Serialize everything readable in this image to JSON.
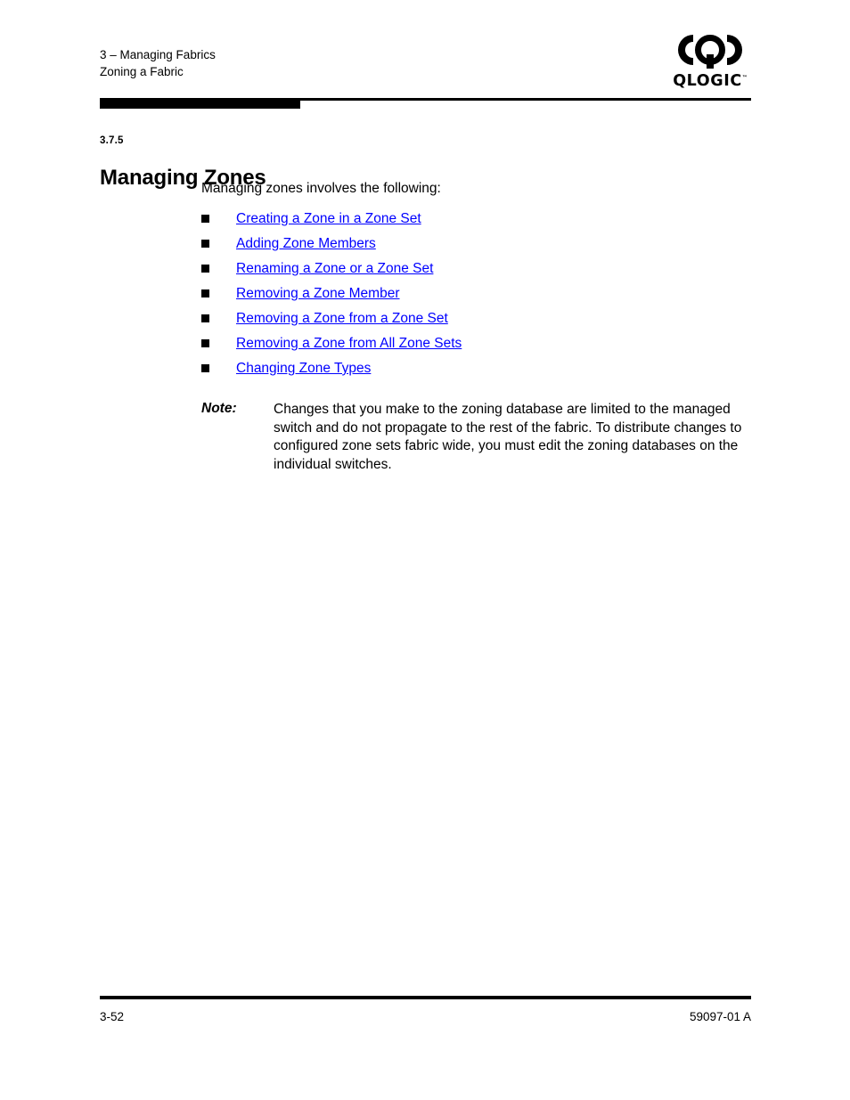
{
  "header": {
    "line1": "3 – Managing Fabrics",
    "line2": "Zoning a Fabric",
    "logo_wordmark": "QLOGIC",
    "logo_tm": "™"
  },
  "section": {
    "number": "3.7.5",
    "title": "Managing Zones"
  },
  "body": {
    "intro": "Managing zones involves the following:",
    "links": [
      {
        "label": "Creating a Zone in a Zone Set"
      },
      {
        "label": "Adding Zone Members"
      },
      {
        "label": "Renaming a Zone or a Zone Set"
      },
      {
        "label": "Removing a Zone Member"
      },
      {
        "label": "Removing a Zone from a Zone Set"
      },
      {
        "label": "Removing a Zone from All Zone Sets"
      },
      {
        "label": "Changing Zone Types"
      }
    ],
    "note": {
      "label": "Note:",
      "text": "Changes that you make to the zoning database are limited to the managed switch and do not propagate to the rest of the fabric. To distribute changes to configured zone sets fabric wide, you must edit the zoning databases on the individual switches."
    }
  },
  "footer": {
    "page_number": "3-52",
    "document_number": "59097-01 A"
  },
  "colors": {
    "link": "#0000FF",
    "text": "#000000",
    "background": "#FFFFFF"
  }
}
